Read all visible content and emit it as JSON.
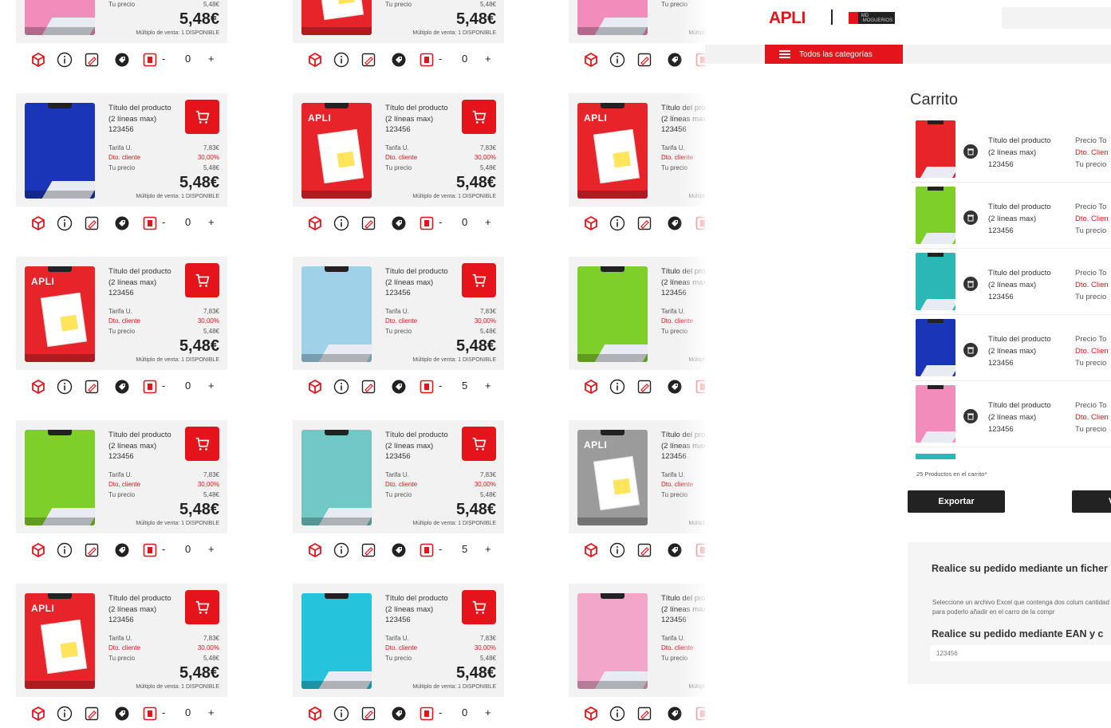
{
  "colors": {
    "accent": "#e5141b",
    "dark": "#222222",
    "bg": "#f2f2f2"
  },
  "product": {
    "title": "Título del producto (2 líneas max) 123456",
    "title_lines": [
      "Título del producto",
      "(2 líneas max)",
      "123456"
    ],
    "tarifa_label": "Tarifa U.",
    "tarifa_value": "7,83€",
    "dto_label": "Dto. cliente",
    "dto_value": "30,00%",
    "tuprecio_label": "Tu precio",
    "tuprecio_value": "5,48€",
    "big_price": "5,48€",
    "multiple": "Múltiplo de venta: 1 DISPONIBLE"
  },
  "grid": {
    "columns": [
      {
        "cards": [
          {
            "thumb": "pink",
            "qty": "0",
            "partial": true
          },
          {
            "thumb": "blue",
            "qty": "0"
          },
          {
            "thumb": "red",
            "qty": "0"
          },
          {
            "thumb": "green",
            "qty": "0"
          },
          {
            "thumb": "red",
            "qty": "0"
          }
        ]
      },
      {
        "cards": [
          {
            "thumb": "red",
            "qty": "0",
            "partial": true
          },
          {
            "thumb": "red",
            "qty": "0"
          },
          {
            "thumb": "nordic-blue",
            "qty": "5"
          },
          {
            "thumb": "nordic-teal",
            "qty": "5"
          },
          {
            "thumb": "cyan",
            "qty": "0"
          }
        ]
      },
      {
        "cards": [
          {
            "thumb": "pink",
            "qty": "",
            "partial": true
          },
          {
            "thumb": "red",
            "qty": ""
          },
          {
            "thumb": "green",
            "qty": ""
          },
          {
            "thumb": "grey-red",
            "qty": ""
          },
          {
            "thumb": "nordic-pink",
            "qty": ""
          }
        ]
      }
    ],
    "icons": [
      "box-icon",
      "info-icon",
      "tag-edit-icon",
      "price-tag-icon",
      "document-icon"
    ],
    "qty_minus": "-",
    "qty_plus": "+"
  },
  "header": {
    "logo": "APLI",
    "sublogo_text": "MD ·MOGUERIOS",
    "categories_label": "Todos las categorías"
  },
  "cart": {
    "title": "Carrito",
    "items": [
      {
        "thumb": "red"
      },
      {
        "thumb": "green"
      },
      {
        "thumb": "teal"
      },
      {
        "thumb": "blue"
      },
      {
        "thumb": "pink"
      }
    ],
    "price_labels": [
      "Precio To",
      "Dto. Clien",
      "Tu precio"
    ],
    "count_text": "25 Productos en el carrito*",
    "export_label": "Exportar",
    "second_button_label": "V"
  },
  "upload": {
    "heading1": "Realice su pedido mediante un ficher",
    "paragraph": "Seleccione un archivo Excel que contenga dos colum cantidad para poderlo añadir en el carro de la compr",
    "heading2": "Realice su pedido mediante EAN y c",
    "ean_value": "123456"
  }
}
